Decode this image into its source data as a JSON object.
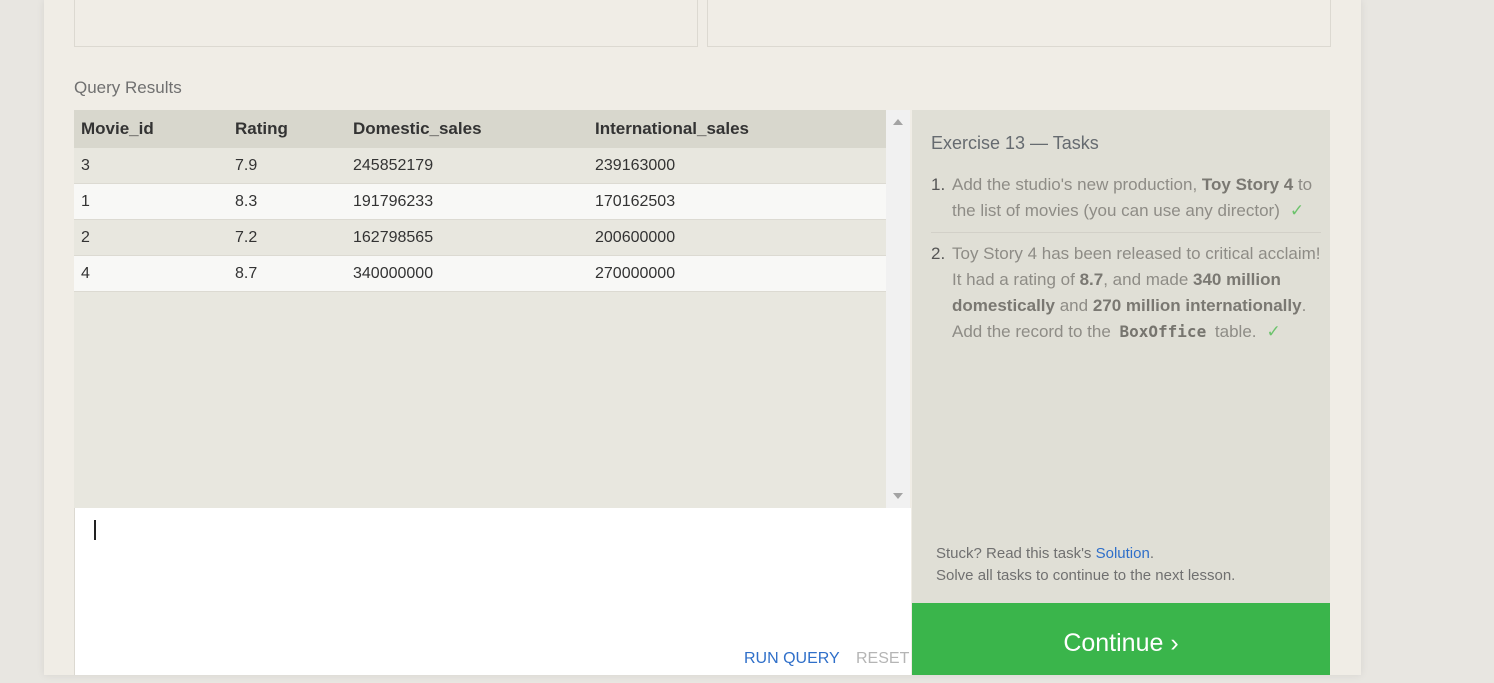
{
  "results": {
    "label": "Query Results",
    "columns": [
      "Movie_id",
      "Rating",
      "Domestic_sales",
      "International_sales"
    ],
    "rows": [
      [
        "3",
        "7.9",
        "245852179",
        "239163000"
      ],
      [
        "1",
        "8.3",
        "191796233",
        "170162503"
      ],
      [
        "2",
        "7.2",
        "162798565",
        "200600000"
      ],
      [
        "4",
        "8.7",
        "340000000",
        "270000000"
      ]
    ]
  },
  "editor": {
    "value": "",
    "run_label": "RUN QUERY",
    "reset_label": "RESET"
  },
  "tasks": {
    "title": "Exercise 13 — Tasks",
    "items": [
      {
        "number": "1.",
        "text_a": "Add the studio's new production, ",
        "bold_a": "Toy Story 4",
        "text_b": " to the list of movies (you can use any director)",
        "check": "✓"
      },
      {
        "number": "2.",
        "text_a": "Toy Story 4 has been released to critical acclaim! It had a rating of ",
        "bold_a": "8.7",
        "text_b": ", and made ",
        "bold_b": "340 million domestically",
        "text_c": " and ",
        "bold_c": "270 million internationally",
        "text_d": ". Add the record to the ",
        "code": "BoxOffice",
        "text_e": " table.",
        "check": "✓"
      }
    ],
    "stuck_text": "Stuck? Read this task's ",
    "solution_link": "Solution",
    "stuck_period": ".",
    "solve_all": "Solve all tasks to continue to the next lesson."
  },
  "continue_label": "Continue ›",
  "colors": {
    "accent_green": "#3ab54b",
    "link_blue": "#2f6fc9",
    "check_green": "#6cc36c"
  }
}
